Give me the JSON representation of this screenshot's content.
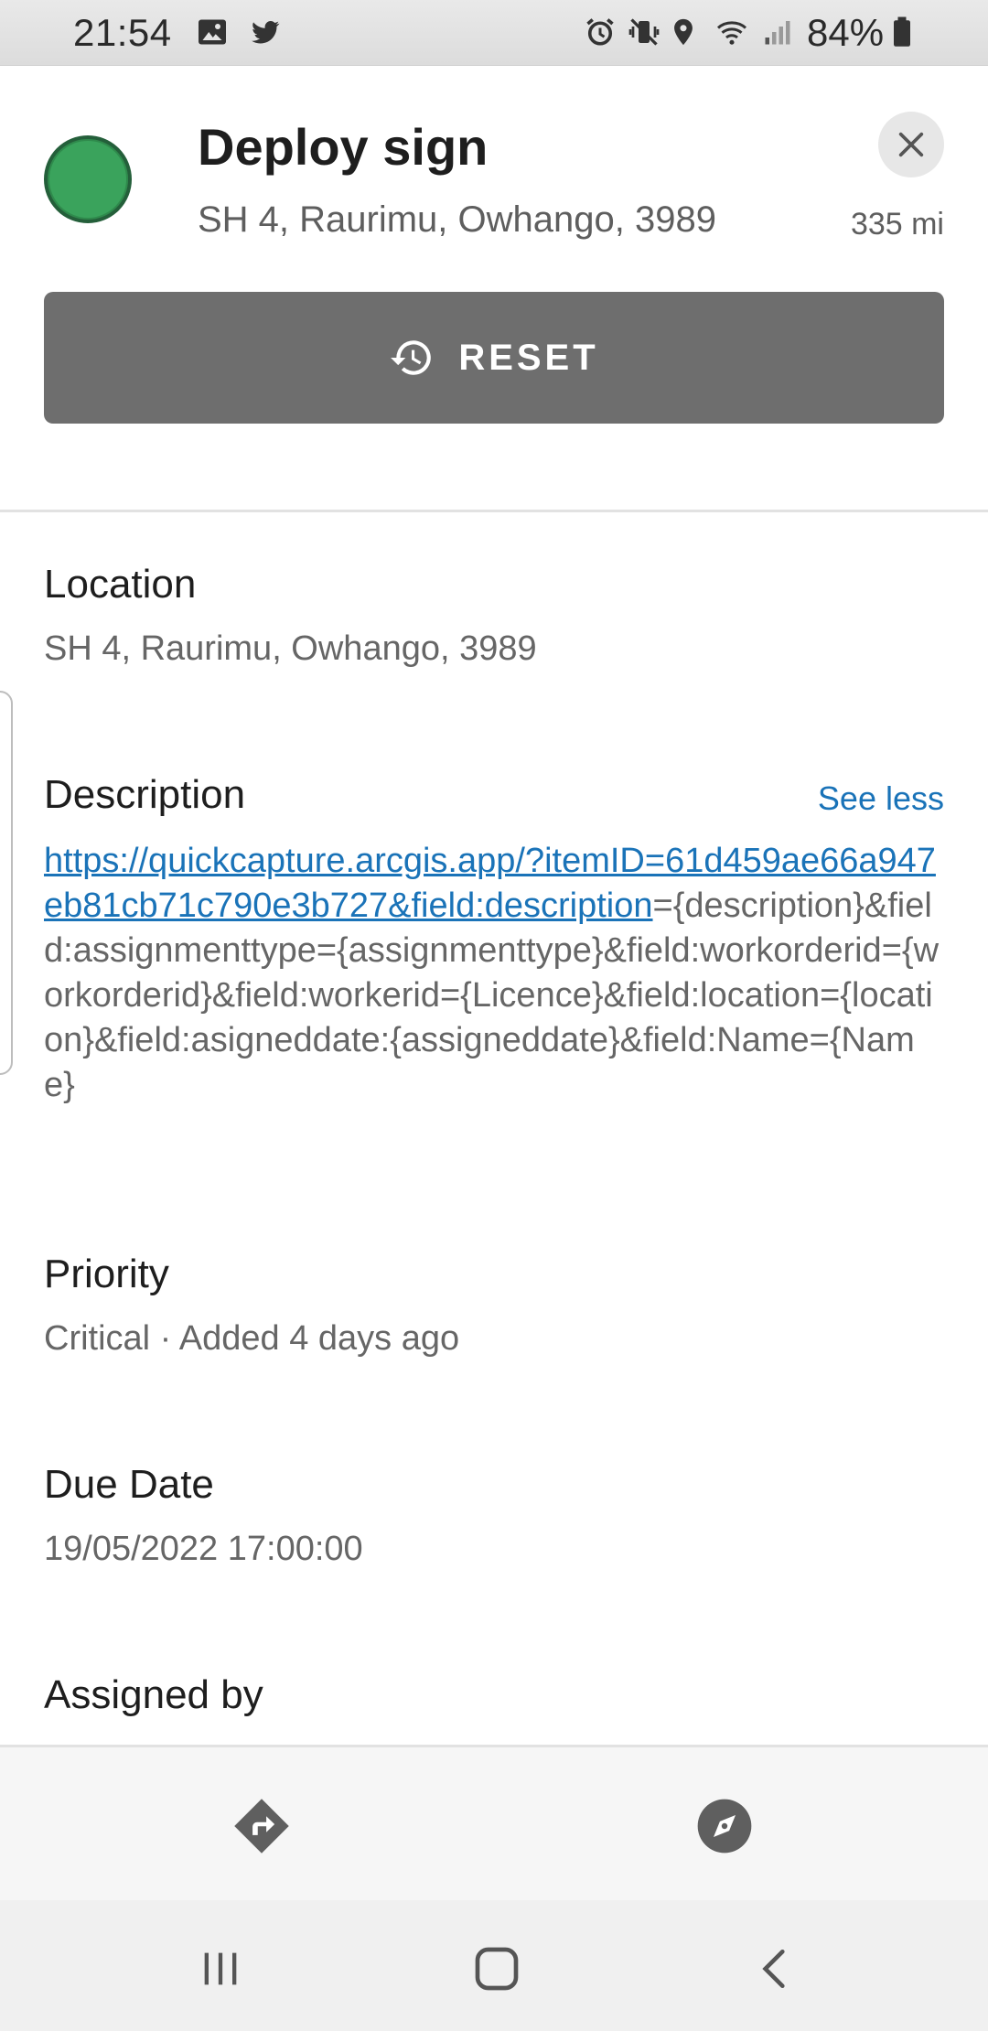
{
  "status_bar": {
    "time": "21:54",
    "battery": "84%",
    "icons": [
      "gallery-icon",
      "twitter-icon",
      "alarm-icon",
      "mute-icon",
      "location-icon",
      "wifi-icon",
      "signal-icon",
      "battery-icon"
    ]
  },
  "header": {
    "title": "Deploy sign",
    "address": "SH 4, Raurimu, Owhango, 3989",
    "distance": "335 mi",
    "status_color": "#3aa35c",
    "reset_label": "RESET"
  },
  "fields": {
    "location": {
      "label": "Location",
      "value": "SH 4, Raurimu, Owhango, 3989"
    },
    "description": {
      "label": "Description",
      "toggle_label": "See less",
      "link_text": "https://quickcapture.arcgis.app/?itemID=61d459ae66a947eb81cb71c790e3b727&field:description",
      "rest_text": "={description}&field:assignmenttype={assignmenttype}&field:workorderid={workorderid}&field:workerid={Licence}&field:location={location}&field:asigneddate:{assigneddate}&field:Name={Name}"
    },
    "priority": {
      "label": "Priority",
      "value": "Critical · Added 4 days ago"
    },
    "due_date": {
      "label": "Due Date",
      "value": "19/05/2022 17:00:00"
    },
    "assigned_by": {
      "label": "Assigned by"
    }
  },
  "colors": {
    "accent": "#1a73b8",
    "reset_bg": "#6e6e6e",
    "action_icon": "#5f5f5f"
  },
  "actions": [
    "directions-icon",
    "navigate-compass-icon"
  ],
  "nav": [
    "recent-apps-icon",
    "home-icon",
    "back-icon"
  ]
}
